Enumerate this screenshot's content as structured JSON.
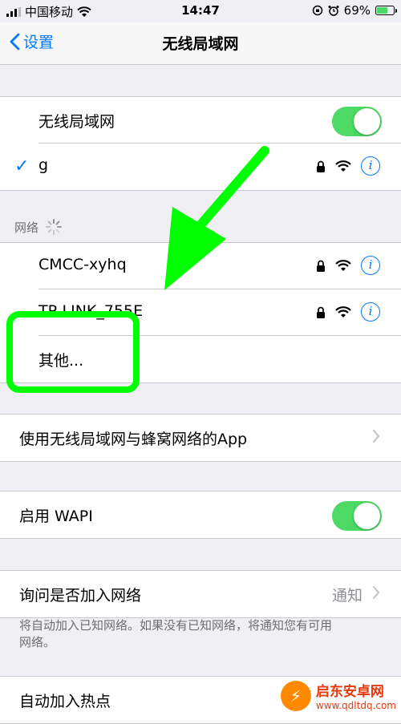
{
  "status_bar": {
    "carrier": "中国移动",
    "time": "14:47",
    "battery_percent": "69%"
  },
  "nav": {
    "back_label": "设置",
    "title": "无线局域网"
  },
  "wifi_group": {
    "toggle_label": "无线局域网",
    "toggle_on": true,
    "connected_network": "g"
  },
  "networks": {
    "header": "网络",
    "items": [
      {
        "name": "CMCC-xyhq"
      },
      {
        "name": "TP-LINK_755E"
      }
    ],
    "other_label": "其他..."
  },
  "apps_row": {
    "label": "使用无线局域网与蜂窝网络的App"
  },
  "wapi": {
    "label": "启用 WAPI",
    "toggle_on": true
  },
  "ask_join": {
    "label": "询问是否加入网络",
    "value": "通知",
    "footer": "将自动加入已知网络。如果没有已知网络，将通知您有可用网络。"
  },
  "hotspot": {
    "label": "自动加入热点"
  },
  "watermark": {
    "title": "启东安卓网",
    "url": "www.qdltdq.com"
  },
  "colors": {
    "accent": "#007aff",
    "toggle_on": "#4cd964",
    "annotation": "#00ff00"
  }
}
